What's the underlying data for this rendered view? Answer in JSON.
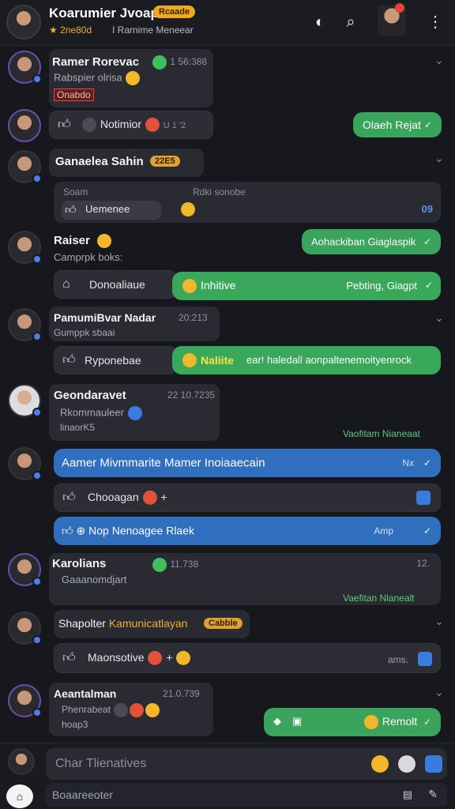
{
  "header": {
    "title": "Koarumier Jvoap",
    "badge": "Rcaade",
    "sub_prefix": "★ 2ne80d",
    "sub_text": "I Rarnime Meneear",
    "icons": [
      "heart-icon",
      "search-icon",
      "profile-icon",
      "more-icon"
    ]
  },
  "rows": [
    {
      "name": "Ramer Rorevac",
      "time": "1 56:388",
      "sub": "Rabspier olrisa",
      "tag": "Onabdo"
    },
    {
      "react_label": "Notimior",
      "react_meta": "U 1 '2",
      "bubble": "Olaeh Rejat"
    },
    {
      "name": "Ganaelea Sahin",
      "tag": "22E5"
    },
    {
      "meta_left": "Soam",
      "meta_right": "Rdki sonobe",
      "react_label": "Uemenee",
      "count": "09"
    },
    {
      "name": "Raiser",
      "sub": "Camprpk boks:",
      "bubble": "Aohackiban Giaglaspik"
    },
    {
      "react_label": "Donoaliaue",
      "hl_text": "Inhitive",
      "bubble_right": "Pebting, Giagpt"
    },
    {
      "name": "PamumiBvar Nadar",
      "time": "20:213",
      "sub": "Gumppk sbaai",
      "react_label": "Ryponebae",
      "hl_text": "Naliite",
      "hl_rest": "ear! haledall aonpaltenemoityenrock"
    },
    {
      "name": "Geondaravet",
      "time": "22 10.7235",
      "sub": "Rkommauleer",
      "sub2": "linaorK5",
      "status": "Vaofitam Nianeaat"
    },
    {
      "bubble": "Aamer Mivmmarite Mamer Inoiaaecain",
      "bubble_meta": "Nx"
    },
    {
      "react_label": "Chooagan",
      "count": "+"
    },
    {
      "bubble": "Nop Nenoagee Rlaek",
      "bubble_meta": "Amp"
    },
    {
      "name": "Karolians",
      "time": "11.738",
      "time_right": "12.",
      "sub": "Gaaanomdjart",
      "status": "Vaefitan Nlanealt"
    },
    {
      "name": "Shapolter",
      "highlight": "Kamunicatlayan",
      "tag": "Cabble"
    },
    {
      "react_label": "Maonsotive",
      "meta": "ams."
    },
    {
      "name": "Aeantalman",
      "time": "21.0.739",
      "sub": "Phenrabeat",
      "sub2": "hoap3",
      "bubble": "Remolt"
    }
  ],
  "composer": {
    "placeholder": "Char Tlienatives",
    "second_line": "Boaareeoter"
  }
}
